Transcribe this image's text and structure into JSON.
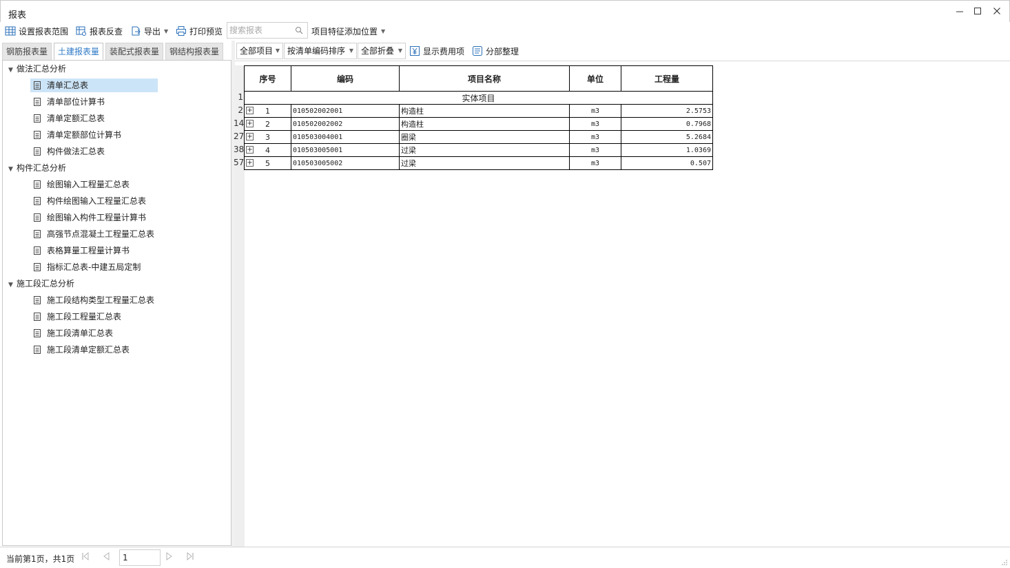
{
  "window": {
    "title": "报表"
  },
  "toolbar": {
    "set_range": "设置报表范围",
    "reverse_check": "报表反查",
    "export": "导出",
    "print_preview": "打印预览",
    "search_placeholder": "搜索报表",
    "feature_position": "项目特征添加位置"
  },
  "tabs": [
    "钢筋报表量",
    "土建报表量",
    "装配式报表量",
    "钢结构报表量"
  ],
  "active_tab": 1,
  "tree": {
    "group1": "做法汇总分析",
    "group1_items": [
      "清单汇总表",
      "清单部位计算书",
      "清单定额汇总表",
      "清单定额部位计算书",
      "构件做法汇总表"
    ],
    "group2": "构件汇总分析",
    "group2_items": [
      "绘图输入工程量汇总表",
      "构件绘图输入工程量汇总表",
      "绘图输入构件工程量计算书",
      "高强节点混凝土工程量汇总表",
      "表格算量工程量计算书",
      "指标汇总表-中建五局定制"
    ],
    "group3": "施工段汇总分析",
    "group3_items": [
      "施工段结构类型工程量汇总表",
      "施工段工程量汇总表",
      "施工段清单汇总表",
      "施工段清单定额汇总表"
    ]
  },
  "report_toolbar": {
    "all_items": "全部项目",
    "sort": "按清单编码排序",
    "fold": "全部折叠",
    "show_fee": "显示费用项",
    "section_arrange": "分部整理"
  },
  "report": {
    "headers": [
      "序号",
      "编码",
      "项目名称",
      "单位",
      "工程量"
    ],
    "section_label": "实体项目",
    "section_rownum": "1",
    "rows": [
      {
        "rownum": "2",
        "seq": "1",
        "code": "010502002001",
        "name": "构造柱",
        "unit": "m3",
        "qty": "2.5753"
      },
      {
        "rownum": "14",
        "seq": "2",
        "code": "010502002002",
        "name": "构造柱",
        "unit": "m3",
        "qty": "0.7968"
      },
      {
        "rownum": "27",
        "seq": "3",
        "code": "010503004001",
        "name": "圈梁",
        "unit": "m3",
        "qty": "5.2684"
      },
      {
        "rownum": "38",
        "seq": "4",
        "code": "010503005001",
        "name": "过梁",
        "unit": "m3",
        "qty": "1.0369"
      },
      {
        "rownum": "57",
        "seq": "5",
        "code": "010503005002",
        "name": "过梁",
        "unit": "m3",
        "qty": "0.507"
      }
    ]
  },
  "status": {
    "page_info": "当前第1页，共1页",
    "page_value": "1"
  }
}
